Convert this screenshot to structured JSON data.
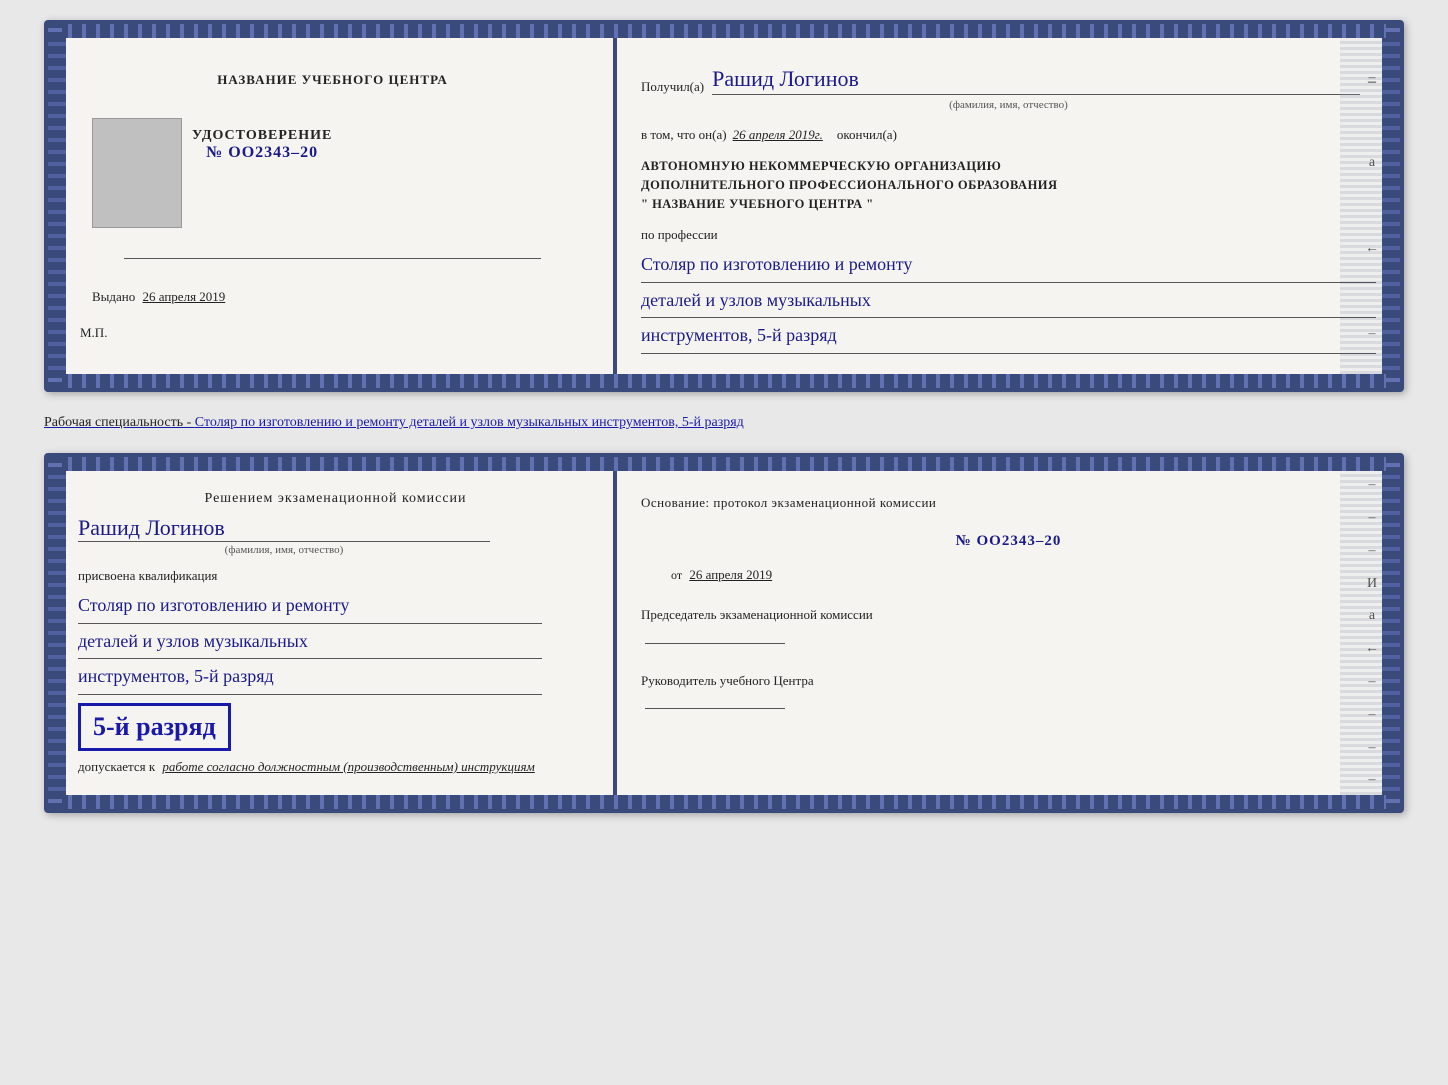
{
  "card1": {
    "left": {
      "center_title": "НАЗВАНИЕ УЧЕБНОГО ЦЕНТРА",
      "udostoverenie_label": "УДОСТОВЕРЕНИЕ",
      "number": "№ OO2343–20",
      "vydano_label": "Выдано",
      "vydano_date": "26 апреля 2019",
      "mp": "М.П."
    },
    "right": {
      "poluchil_label": "Получил(а)",
      "recipient_name": "Рашид Логинов",
      "fio_hint": "(фамилия, имя, отчество)",
      "dash": "–",
      "vtom_label": "в том, что он(а)",
      "vtom_date": "26 апреля 2019г.",
      "okonchil": "окончил(а)",
      "org_line1": "АВТОНОМНУЮ НЕКОММЕРЧЕСКУЮ ОРГАНИЗАЦИЮ",
      "org_line2": "ДОПОЛНИТЕЛЬНОГО ПРОФЕССИОНАЛЬНОГО ОБРАЗОВАНИЯ",
      "org_line3": "\"   НАЗВАНИЕ УЧЕБНОГО ЦЕНТРА   \"",
      "po_professii": "по профессии",
      "profession1": "Столяр по изготовлению и ремонту",
      "profession2": "деталей и узлов музыкальных",
      "profession3": "инструментов, 5-й разряд"
    }
  },
  "specialty_label": "Рабочая специальность - Столяр по изготовлению и ремонту деталей и узлов музыкальных инструментов, 5-й разряд",
  "card2": {
    "left": {
      "resheniye": "Решением экзаменационной комиссии",
      "person_name": "Рашид Логинов",
      "fio_hint": "(фамилия, имя, отчество)",
      "prisvoena": "присвоена квалификация",
      "qual1": "Столяр по изготовлению и ремонту",
      "qual2": "деталей и узлов музыкальных",
      "qual3": "инструментов, 5-й разряд",
      "rank_text": "5-й разряд",
      "dopuskaetsya_label": "допускается к",
      "dopuskaetsya_value": "работе согласно должностным (производственным) инструкциям"
    },
    "right": {
      "osnovanie_label": "Основание: протокол экзаменационной комиссии",
      "protocol_number": "№ OO2343–20",
      "ot_label": "от",
      "ot_date": "26 апреля 2019",
      "predsedatel_label": "Председатель экзаменационной комиссии",
      "rukovoditel_label": "Руководитель учебного Центра"
    }
  },
  "side_marks_top": [
    "–",
    "а",
    "←",
    "–"
  ],
  "side_marks_bottom": [
    "–",
    "–",
    "–",
    "И",
    "а",
    "←",
    "–",
    "–",
    "–",
    "–"
  ]
}
